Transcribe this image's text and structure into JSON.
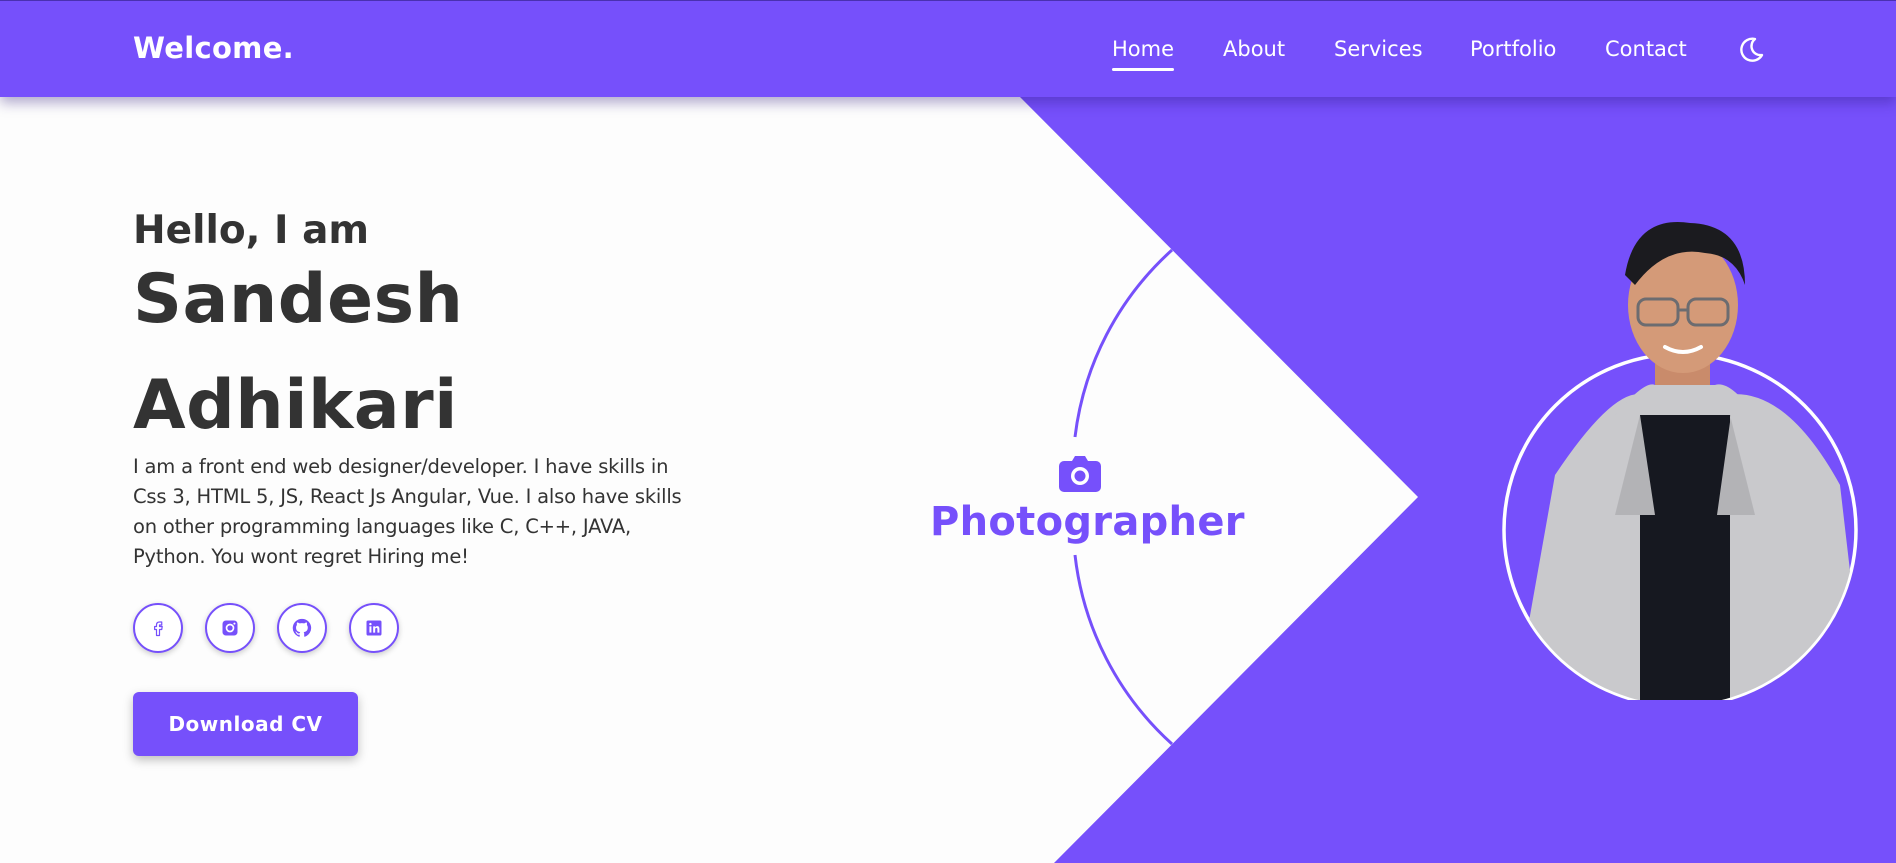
{
  "nav": {
    "logo": "Welcome.",
    "links": [
      {
        "label": "Home",
        "active": true
      },
      {
        "label": "About",
        "active": false
      },
      {
        "label": "Services",
        "active": false
      },
      {
        "label": "Portfolio",
        "active": false
      },
      {
        "label": "Contact",
        "active": false
      }
    ],
    "theme_icon": "moon-icon"
  },
  "hero": {
    "greeting": "Hello, I am",
    "first_name": "Sandesh",
    "last_name": "Adhikari",
    "description": "I am a front end web designer/developer. I have skills in Css 3, HTML 5, JS, React Js Angular, Vue. I also have skills on other programming languages like C, C++, JAVA, Python. You wont regret Hiring me!",
    "socials": [
      "facebook-icon",
      "instagram-icon",
      "github-icon",
      "linkedin-icon"
    ],
    "cv_button": "Download CV"
  },
  "role": {
    "icon": "camera-icon",
    "label": "Photographer"
  },
  "colors": {
    "accent": "#7650fb",
    "text": "#333333",
    "background": "#fdfdfd"
  }
}
